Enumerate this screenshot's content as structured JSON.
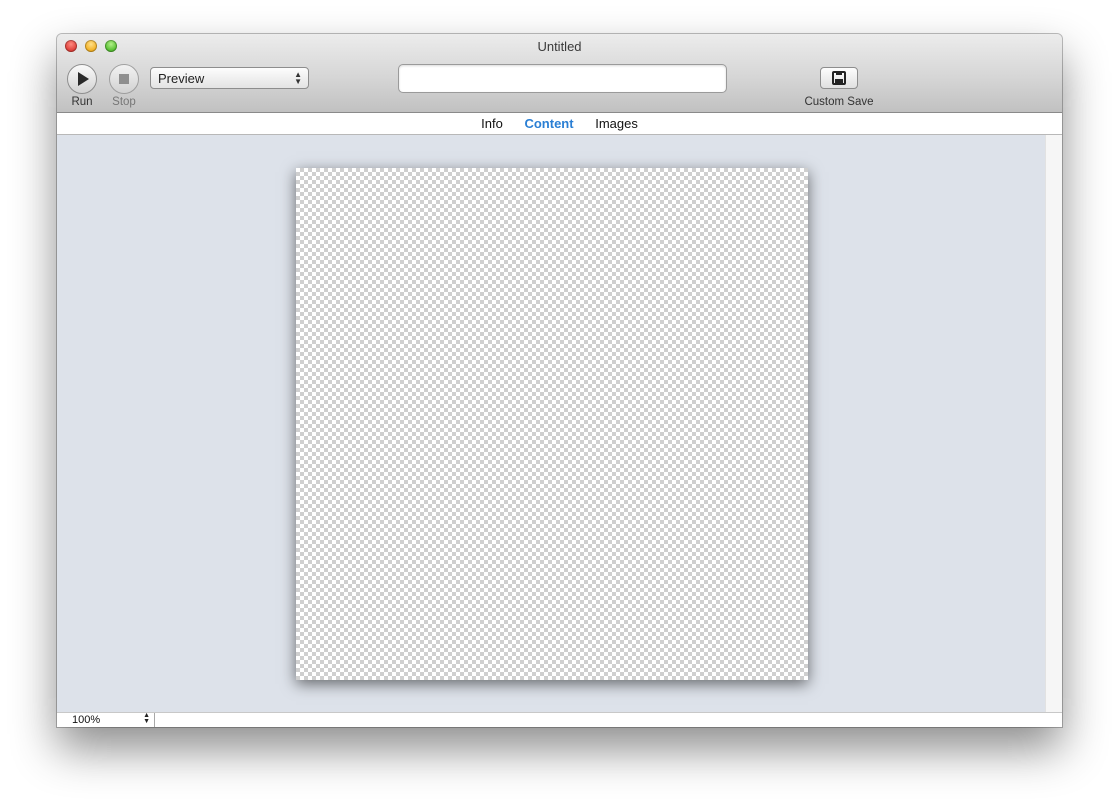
{
  "window": {
    "title": "Untitled"
  },
  "toolbar": {
    "run_label": "Run",
    "stop_label": "Stop",
    "mode_select": {
      "selected": "Preview"
    },
    "url_field": {
      "value": "",
      "placeholder": ""
    },
    "custom_save_label": "Custom Save"
  },
  "tabs": [
    {
      "label": "Info",
      "active": false
    },
    {
      "label": "Content",
      "active": true
    },
    {
      "label": "Images",
      "active": false
    }
  ],
  "status": {
    "zoom": "100%"
  },
  "colors": {
    "active_tab": "#2a7fd4",
    "content_background": "#dde2ea"
  },
  "icons": {
    "run": "play-icon",
    "stop": "stop-icon",
    "save": "floppy-disk-icon"
  }
}
